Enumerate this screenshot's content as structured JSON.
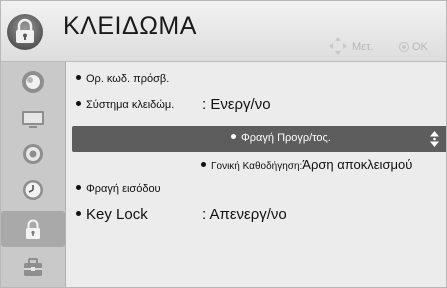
{
  "header": {
    "title": "ΚΛΕΙΔΩΜΑ",
    "icon": "padlock-icon",
    "nav_move_label": "Μετ.",
    "nav_ok_label": "OK"
  },
  "sidebar": {
    "items": [
      {
        "icon": "picture-icon"
      },
      {
        "icon": "screen-icon"
      },
      {
        "icon": "speaker-icon"
      },
      {
        "icon": "clock-icon"
      },
      {
        "icon": "lock-icon",
        "active": true
      },
      {
        "icon": "toolbox-icon"
      }
    ]
  },
  "menu": {
    "items": [
      {
        "label": "Ορ. κωδ. πρόσβ."
      },
      {
        "label": "Σύστημα κλειδώμ.",
        "value": ": Ενεργ/νο"
      },
      {
        "label": "Φραγή Προγρ/τος.",
        "selected": true
      },
      {
        "label": "Γονική Καθοδήγηση:",
        "value": "Άρση αποκλεισμού"
      },
      {
        "label": "Φραγή εισόδου"
      },
      {
        "label": "Key Lock",
        "value": ": Απενεργ/νο"
      }
    ]
  },
  "colors": {
    "highlight": "#5d5d5d",
    "background": "#ececec",
    "sidebar": "#c9c9c9"
  }
}
